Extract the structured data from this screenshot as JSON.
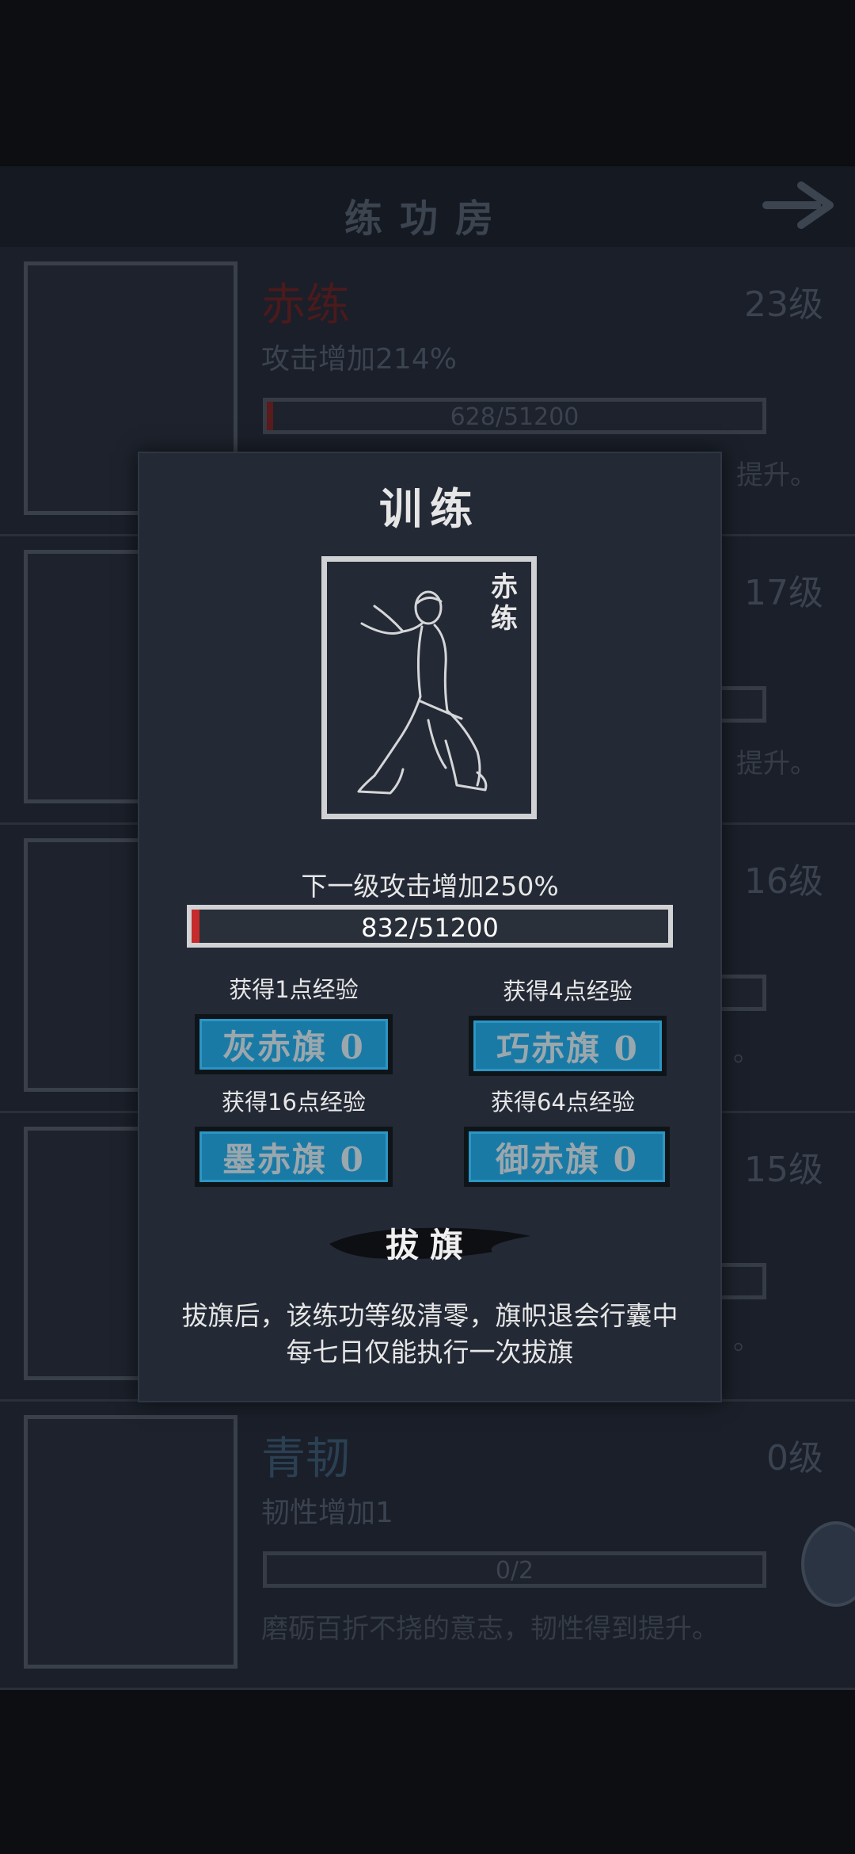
{
  "header": {
    "title": "练功房"
  },
  "cards": [
    {
      "name": "赤练",
      "level": "23级",
      "desc": "攻击增加214%",
      "progress_text": "628/51200",
      "progress": 0.012,
      "note": "提升。",
      "name_style": "red"
    },
    {
      "name": "",
      "level": "17级",
      "desc": "",
      "progress_text": "",
      "progress": 0,
      "note": "提升。",
      "name_style": "red"
    },
    {
      "name": "",
      "level": "16级",
      "desc": "",
      "progress_text": "",
      "progress": 0,
      "note": "。",
      "name_style": "red"
    },
    {
      "name": "",
      "level": "15级",
      "desc": "",
      "progress_text": "",
      "progress": 0.05,
      "note": "。",
      "name_style": "blue"
    },
    {
      "name": "青韧",
      "level": "0级",
      "desc": "韧性增加1",
      "progress_text": "0/2",
      "progress": 0,
      "note": "磨砺百折不挠的意志，韧性得到提升。",
      "name_style": "blue"
    }
  ],
  "modal": {
    "title": "训练",
    "portrait_label": "赤练",
    "next_level": "下一级攻击增加250%",
    "exp_text": "832/51200",
    "exp_progress": 0.016,
    "flags": [
      {
        "label": "获得1点经验",
        "button": "灰赤旗 0"
      },
      {
        "label": "获得4点经验",
        "button": "巧赤旗 0"
      },
      {
        "label": "获得16点经验",
        "button": "墨赤旗 0"
      },
      {
        "label": "获得64点经验",
        "button": "御赤旗 0"
      }
    ],
    "pull_button": "拔旗",
    "notes": [
      "拔旗后，该练功等级清零，旗帜退会行囊中",
      "每七日仅能执行一次拔旗"
    ]
  },
  "colors": {
    "flag_button": "#1a7aa6",
    "exp_fill": "#c62a2a",
    "modal_bg": "#232935"
  }
}
